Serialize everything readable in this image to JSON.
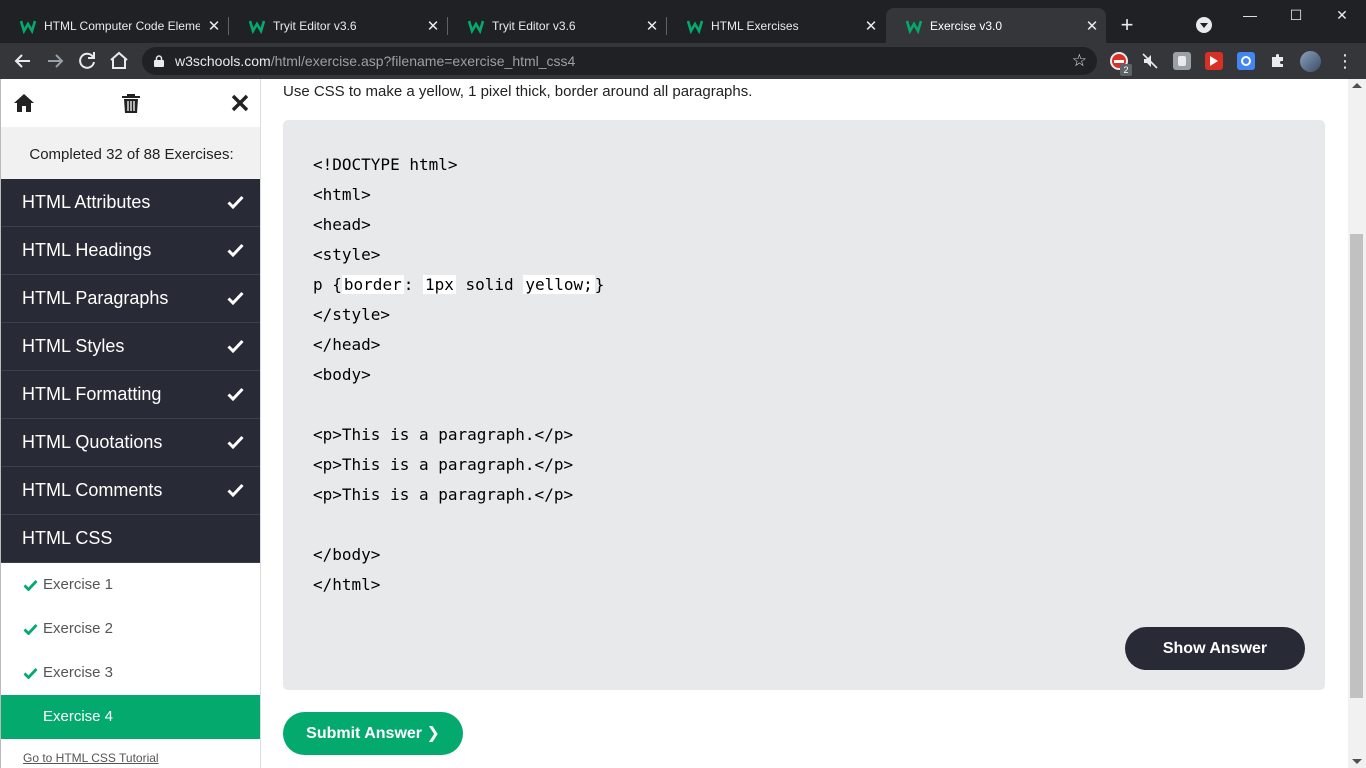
{
  "browser": {
    "tabs": [
      {
        "title": "HTML Computer Code Eleme",
        "active": false
      },
      {
        "title": "Tryit Editor v3.6",
        "active": false
      },
      {
        "title": "Tryit Editor v3.6",
        "active": false
      },
      {
        "title": "HTML Exercises",
        "active": false
      },
      {
        "title": "Exercise v3.0",
        "active": true
      }
    ],
    "close_glyph": "✕",
    "new_tab_glyph": "+",
    "url_host": "w3schools.com",
    "url_path": "/html/exercise.asp?filename=exercise_html_css4",
    "extension_badge": "2",
    "window_controls": {
      "minimize": "—",
      "maximize": "☐",
      "close": "✕"
    },
    "accent_color": "#04aa6d"
  },
  "sidebar": {
    "tools": [
      "home-icon",
      "trash-icon",
      "close-icon"
    ],
    "completed_text": "Completed 32 of 88 Exercises:",
    "chapters": [
      {
        "label": "HTML Attributes",
        "done": true
      },
      {
        "label": "HTML Headings",
        "done": true
      },
      {
        "label": "HTML Paragraphs",
        "done": true
      },
      {
        "label": "HTML Styles",
        "done": true
      },
      {
        "label": "HTML Formatting",
        "done": true
      },
      {
        "label": "HTML Quotations",
        "done": true
      },
      {
        "label": "HTML Comments",
        "done": true
      },
      {
        "label": "HTML CSS",
        "done": false
      }
    ],
    "exercises": [
      {
        "label": "Exercise 1",
        "done": true
      },
      {
        "label": "Exercise 2",
        "done": true
      },
      {
        "label": "Exercise 3",
        "done": true
      },
      {
        "label": "Exercise 4",
        "done": false,
        "active": true
      }
    ],
    "tutorial_link": "Go to HTML CSS Tutorial"
  },
  "main": {
    "prompt": "Use CSS to make a yellow, 1 pixel thick, border around all paragraphs.",
    "code_lines": [
      "<!DOCTYPE html>",
      "<html>",
      "<head>",
      "<style>",
      "",
      "</style>",
      "</head>",
      "<body>",
      "",
      "<p>This is a paragraph.</p>",
      "<p>This is a paragraph.</p>",
      "<p>This is a paragraph.</p>",
      "",
      "</body>",
      "</html>"
    ],
    "css_line": {
      "p_open": "p {",
      "field_1": "border",
      "colon": ": ",
      "field_2": "1px",
      "middle": " solid ",
      "field_3": "yellow;",
      "close": "}"
    },
    "show_answer_label": "Show Answer",
    "submit_label": "Submit Answer ❯"
  }
}
